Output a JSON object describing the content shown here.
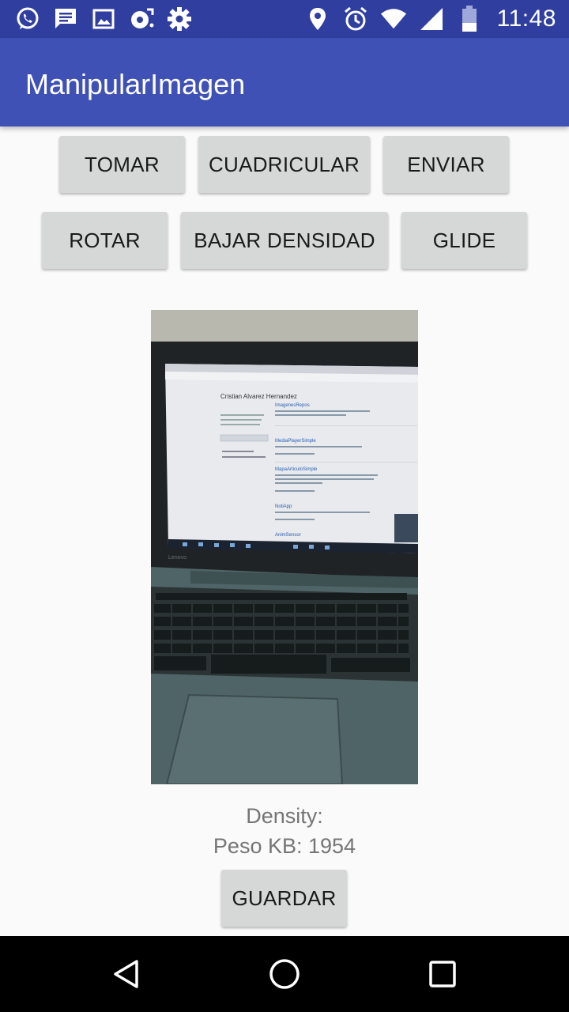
{
  "status_bar": {
    "time": "11:48",
    "left_icons": [
      "whatsapp-icon",
      "message-icon",
      "image-icon",
      "sync-icon",
      "settings-icon"
    ],
    "right_icons": [
      "location-icon",
      "alarm-icon",
      "wifi-icon",
      "signal-icon",
      "battery-icon"
    ]
  },
  "app_bar": {
    "title": "ManipularImagen"
  },
  "buttons": {
    "tomar": "TOMAR",
    "cuadricular": "CUADRICULAR",
    "enviar": "ENVIAR",
    "rotar": "ROTAR",
    "bajar_densidad": "BAJAR DENSIDAD",
    "glide": "GLIDE",
    "guardar": "GUARDAR"
  },
  "image_info": {
    "density_label": "Density:",
    "weight_label": "Peso KB: 1954"
  },
  "photo_screen": {
    "name": "Cristian Alvarez Hernandez",
    "brand": "Lenovo",
    "items": [
      "ImagenesRepos",
      "MediaPlayerSimple",
      "MapaArticuloSimple",
      "NotiApp",
      "AnimSensor"
    ]
  },
  "colors": {
    "status_bar": "#303f9f",
    "app_bar": "#3f51b5",
    "button": "#d6d7d7",
    "background": "#fafafa"
  }
}
